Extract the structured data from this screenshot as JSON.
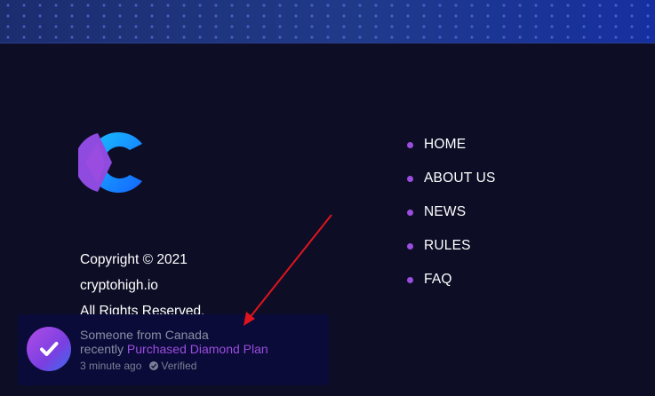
{
  "footer": {
    "copyright_line1": "Copyright © 2021",
    "copyright_line2": "cryptohigh.io",
    "copyright_line3": "All Rights Reserved."
  },
  "nav": {
    "items": [
      {
        "label": "HOME"
      },
      {
        "label": "ABOUT US"
      },
      {
        "label": "NEWS"
      },
      {
        "label": "RULES"
      },
      {
        "label": "FAQ"
      }
    ]
  },
  "notification": {
    "line1": "Someone from Canada",
    "line2_prefix": "recently",
    "line2_highlight": "Purchased Diamond Plan",
    "time": "3 minute ago",
    "verified": "Verified",
    "icon": "check-icon"
  },
  "colors": {
    "background": "#0d0e26",
    "accent_purple": "#9b4de0",
    "logo_blue": "#1a8cff",
    "arrow_red": "#e0141e"
  }
}
